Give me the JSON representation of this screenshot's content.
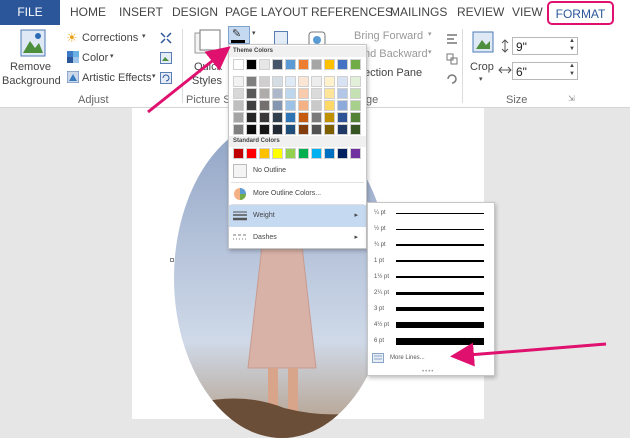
{
  "tabs": {
    "file": "FILE",
    "home": "HOME",
    "insert": "INSERT",
    "design": "DESIGN",
    "page_layout": "PAGE LAYOUT",
    "references": "REFERENCES",
    "mailings": "MAILINGS",
    "review": "REVIEW",
    "view": "VIEW",
    "format": "FORMAT"
  },
  "ribbon": {
    "remove_background": {
      "line1": "Remove",
      "line2": "Background"
    },
    "corrections": "Corrections",
    "color": "Color",
    "artistic_effects": "Artistic Effects",
    "adjust_group": "Adjust",
    "quick_styles": {
      "line1": "Quick",
      "line2": "Styles"
    },
    "picture_styles_group": "Picture St",
    "bring_forward": "Bring Forward",
    "send_backward": "nd Backward",
    "selection_pane": "ection Pane",
    "arrange_group_fragment": "ge",
    "crop": "Crop",
    "height_value": "9\"",
    "width_value": "6\"",
    "size_group": "Size"
  },
  "outline_menu": {
    "theme_colors_header": "Theme Colors",
    "standard_colors_header": "Standard Colors",
    "no_outline": "No Outline",
    "more_outline_colors": "More Outline Colors...",
    "weight": "Weight",
    "dashes": "Dashes",
    "theme_top_row": [
      "#ffffff",
      "#000000",
      "#e7e6e6",
      "#44546a",
      "#5b9bd5",
      "#ed7d31",
      "#a5a5a5",
      "#ffc000",
      "#4472c4",
      "#70ad47"
    ],
    "theme_tints": [
      [
        "#f2f2f2",
        "#7f7f7f",
        "#d0cece",
        "#d6dce4",
        "#deebf6",
        "#fbe5d5",
        "#ededed",
        "#fff2cc",
        "#d9e2f3",
        "#e2efd9"
      ],
      [
        "#d8d8d8",
        "#595959",
        "#aeabab",
        "#adb9ca",
        "#bdd7ee",
        "#f7cbac",
        "#dbdbdb",
        "#fee599",
        "#b4c6e7",
        "#c5e0b3"
      ],
      [
        "#bfbfbf",
        "#3f3f3f",
        "#757070",
        "#8496b0",
        "#9cc3e5",
        "#f4b183",
        "#c9c9c9",
        "#ffd965",
        "#8eaadb",
        "#a8d08d"
      ],
      [
        "#a5a5a5",
        "#262626",
        "#3a3838",
        "#323f4f",
        "#2e75b5",
        "#c55a11",
        "#7b7b7b",
        "#bf9000",
        "#2f5496",
        "#538135"
      ],
      [
        "#7f7f7f",
        "#0c0c0c",
        "#171616",
        "#222a35",
        "#1e4e79",
        "#833c0b",
        "#525252",
        "#7f6000",
        "#1f3864",
        "#375623"
      ]
    ],
    "standard_colors": [
      "#c00000",
      "#ff0000",
      "#ffc000",
      "#ffff00",
      "#92d050",
      "#00b050",
      "#00b0f0",
      "#0070c0",
      "#002060",
      "#7030a0"
    ]
  },
  "weight_submenu": {
    "weights": [
      "¼ pt",
      "½ pt",
      "¾ pt",
      "1 pt",
      "1½ pt",
      "2¼ pt",
      "3 pt",
      "4½ pt",
      "6 pt"
    ],
    "more_lines": "More Lines..."
  },
  "colors": {
    "accent": "#2b579a",
    "highlight": "#e0106e",
    "selected_item": "#c5d9f1"
  }
}
